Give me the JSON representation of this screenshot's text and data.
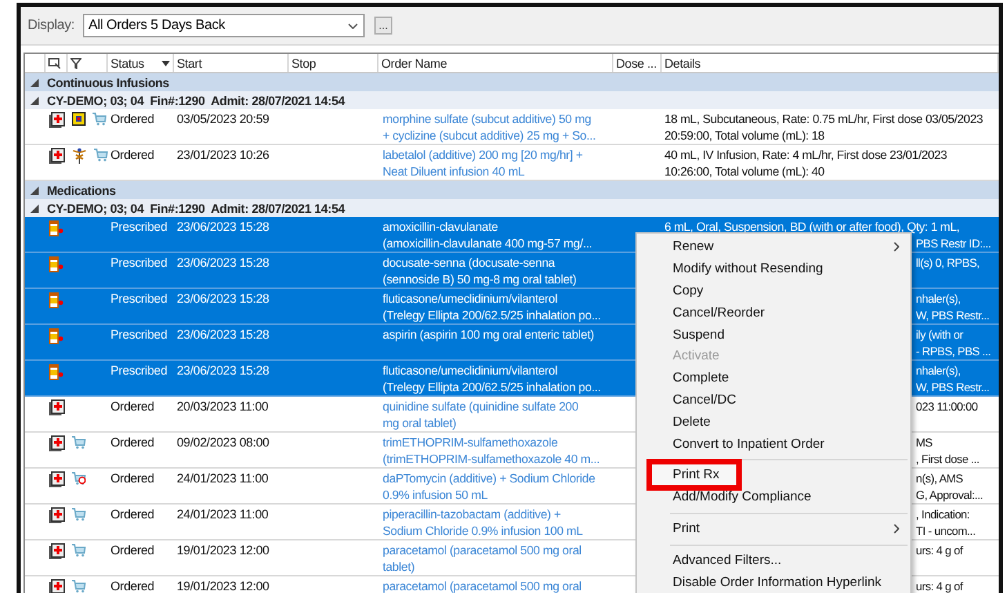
{
  "toolbar": {
    "display_label": "Display:",
    "display_value": "All Orders 5 Days Back",
    "more_button": "..."
  },
  "columns": [
    "Status",
    "Start",
    "Stop",
    "Order Name",
    "Dose ...",
    "Details"
  ],
  "sections": [
    {
      "title": "Continuous Infusions",
      "expanded": true,
      "encounters": [
        {
          "label": "CY-DEMO; 03; 04  Fin#:1290  Admit: 28/07/2021 14:54",
          "expanded": true,
          "rows": [
            {
              "icons": [
                {
                  "kind": "order"
                },
                {
                  "kind": "alert"
                },
                {
                  "kind": "cart"
                }
              ],
              "status": "Ordered",
              "start": "03/05/2023 20:59",
              "order_name": [
                "morphine sulfate (subcut additive) 50 mg",
                "+ cyclizine (subcut additive) 25 mg + So..."
              ],
              "details": [
                {
                  "text": "18 mL, Subcutaneous, Rate: 0.75 mL/hr, First dose 03/05/2023",
                  "kind": "full"
                },
                {
                  "text": "20:59:00, Total volume (mL): 18",
                  "kind": "full"
                }
              ],
              "selected": false
            },
            {
              "icons": [
                {
                  "kind": "order"
                },
                {
                  "kind": "caduceus"
                },
                {
                  "kind": "cart"
                }
              ],
              "status": "Ordered",
              "start": "23/01/2023 10:26",
              "order_name": [
                "labetalol (additive) 200 mg [20 mg/hr] +",
                "Neat Diluent infusion 40 mL"
              ],
              "details": [
                {
                  "text": "40 mL, IV Infusion, Rate: 4 mL/hr, First dose 23/01/2023",
                  "kind": "full"
                },
                {
                  "text": "10:26:00, Total volume (mL): 40",
                  "kind": "full"
                }
              ],
              "selected": false
            }
          ]
        }
      ]
    },
    {
      "title": "Medications",
      "expanded": true,
      "encounters": [
        {
          "label": "CY-DEMO; 03; 04  Fin#:1290  Admit: 28/07/2021 14:54",
          "expanded": true,
          "rows": [
            {
              "icons": [
                {
                  "kind": "bottle"
                }
              ],
              "status": "Prescribed",
              "start": "23/06/2023 15:28",
              "order_name": [
                "amoxicillin-clavulanate",
                "(amoxicillin-clavulanate 400 mg-57 mg/..."
              ],
              "details": [
                {
                  "text": "6 mL, Oral, Suspension, BD (with or after food), Qty: 1 mL,",
                  "kind": "full"
                },
                {
                  "text": "PBS Restr ID:...",
                  "kind": "clipped"
                }
              ],
              "selected": true
            },
            {
              "icons": [
                {
                  "kind": "bottle"
                }
              ],
              "status": "Prescribed",
              "start": "23/06/2023 15:28",
              "order_name": [
                "docusate-senna (docusate-senna",
                "(sennoside B) 50 mg-8 mg oral tablet)"
              ],
              "details": [
                {
                  "text": "ll(s) 0, RPBS,",
                  "kind": "clipped"
                }
              ],
              "selected": true
            },
            {
              "icons": [
                {
                  "kind": "bottle"
                }
              ],
              "status": "Prescribed",
              "start": "23/06/2023 15:28",
              "order_name": [
                "fluticasone/umeclidinium/vilanterol",
                "(Trelegy Ellipta 200/62.5/25 inhalation po..."
              ],
              "details": [
                {
                  "text": "nhaler(s),",
                  "kind": "clipped"
                },
                {
                  "text": "W, PBS Restr...",
                  "kind": "clipped"
                }
              ],
              "selected": true
            },
            {
              "icons": [
                {
                  "kind": "bottle"
                }
              ],
              "status": "Prescribed",
              "start": "23/06/2023 15:28",
              "order_name": [
                "aspirin (aspirin 100 mg oral enteric tablet)"
              ],
              "details": [
                {
                  "text": "ily (with or",
                  "kind": "clipped"
                },
                {
                  "text": "- RPBS, PBS ...",
                  "kind": "clipped"
                }
              ],
              "selected": true
            },
            {
              "icons": [
                {
                  "kind": "bottle"
                }
              ],
              "status": "Prescribed",
              "start": "23/06/2023 15:28",
              "order_name": [
                "fluticasone/umeclidinium/vilanterol",
                "(Trelegy Ellipta 200/62.5/25 inhalation po..."
              ],
              "details": [
                {
                  "text": "nhaler(s),",
                  "kind": "clipped"
                },
                {
                  "text": "W, PBS Restr...",
                  "kind": "clipped"
                }
              ],
              "selected": true
            },
            {
              "icons": [
                {
                  "kind": "order"
                }
              ],
              "status": "Ordered",
              "start": "20/03/2023 11:00",
              "order_name": [
                "quinidine sulfate (quinidine sulfate 200",
                "mg oral tablet)"
              ],
              "details": [
                {
                  "text": "023 11:00:00",
                  "kind": "clipped"
                }
              ],
              "selected": false
            },
            {
              "icons": [
                {
                  "kind": "order"
                },
                {
                  "kind": "cart"
                }
              ],
              "status": "Ordered",
              "start": "09/02/2023 08:00",
              "order_name": [
                "trimETHOPRIM-sulfamethoxazole",
                "(trimETHOPRIM-sulfamethoxazole 40 m..."
              ],
              "details": [
                {
                  "text": "MS",
                  "kind": "clipped"
                },
                {
                  "text": ", First dose ...",
                  "kind": "clipped"
                }
              ],
              "selected": false
            },
            {
              "icons": [
                {
                  "kind": "order"
                },
                {
                  "kind": "cart-blocked"
                }
              ],
              "status": "Ordered",
              "start": "24/01/2023 11:00",
              "order_name": [
                "daPTomycin (additive) + Sodium Chloride",
                "0.9% infusion 50 mL"
              ],
              "details": [
                {
                  "text": "n(s), AMS",
                  "kind": "clipped"
                },
                {
                  "text": "G, Approval:...",
                  "kind": "clipped"
                }
              ],
              "selected": false
            },
            {
              "icons": [
                {
                  "kind": "order"
                },
                {
                  "kind": "cart"
                }
              ],
              "status": "Ordered",
              "start": "24/01/2023 11:00",
              "order_name": [
                "piperacillin-tazobactam (additive) +",
                "Sodium Chloride 0.9% infusion 100 mL"
              ],
              "details": [
                {
                  "text": ", Indication:",
                  "kind": "clipped"
                },
                {
                  "text": "TI - uncom...",
                  "kind": "clipped"
                }
              ],
              "selected": false
            },
            {
              "icons": [
                {
                  "kind": "order"
                },
                {
                  "kind": "cart"
                }
              ],
              "status": "Ordered",
              "start": "19/01/2023 12:00",
              "order_name": [
                "paracetamol (paracetamol 500 mg oral",
                "tablet)"
              ],
              "details": [
                {
                  "text": "urs: 4 g of",
                  "kind": "clipped"
                }
              ],
              "selected": false
            },
            {
              "icons": [
                {
                  "kind": "order"
                },
                {
                  "kind": "cart"
                }
              ],
              "status": "Ordered",
              "start": "19/01/2023 12:00",
              "order_name": [
                "paracetamol (paracetamol 500 mg oral"
              ],
              "details": [
                {
                  "text": "urs: 4 g of",
                  "kind": "clipped"
                }
              ],
              "selected": false
            }
          ]
        }
      ]
    }
  ],
  "context_menu": [
    {
      "kind": "item",
      "label": "Renew",
      "submenu": true,
      "disabled": false,
      "highlighted": false
    },
    {
      "kind": "item",
      "label": "Modify without Resending",
      "submenu": false,
      "disabled": false,
      "highlighted": false
    },
    {
      "kind": "item",
      "label": "Copy",
      "submenu": false,
      "disabled": false,
      "highlighted": false
    },
    {
      "kind": "item",
      "label": "Cancel/Reorder",
      "submenu": false,
      "disabled": false,
      "highlighted": false
    },
    {
      "kind": "item",
      "label": "Suspend",
      "submenu": false,
      "disabled": false,
      "highlighted": false
    },
    {
      "kind": "item",
      "label": "Activate",
      "submenu": false,
      "disabled": true,
      "highlighted": false
    },
    {
      "kind": "item",
      "label": "Complete",
      "submenu": false,
      "disabled": false,
      "highlighted": false
    },
    {
      "kind": "item",
      "label": "Cancel/DC",
      "submenu": false,
      "disabled": false,
      "highlighted": false
    },
    {
      "kind": "item",
      "label": "Delete",
      "submenu": false,
      "disabled": false,
      "highlighted": false
    },
    {
      "kind": "item",
      "label": "Convert to Inpatient Order",
      "submenu": false,
      "disabled": false,
      "highlighted": false
    },
    {
      "kind": "separator"
    },
    {
      "kind": "item",
      "label": "Print Rx",
      "submenu": false,
      "disabled": false,
      "highlighted": true
    },
    {
      "kind": "item",
      "label": "Add/Modify Compliance",
      "submenu": false,
      "disabled": false,
      "highlighted": false
    },
    {
      "kind": "separator"
    },
    {
      "kind": "item",
      "label": "Print",
      "submenu": true,
      "disabled": false,
      "highlighted": false
    },
    {
      "kind": "separator"
    },
    {
      "kind": "item",
      "label": "Advanced Filters...",
      "submenu": false,
      "disabled": false,
      "highlighted": false
    },
    {
      "kind": "item",
      "label": "Disable Order Information Hyperlink",
      "submenu": false,
      "disabled": false,
      "highlighted": false
    }
  ]
}
